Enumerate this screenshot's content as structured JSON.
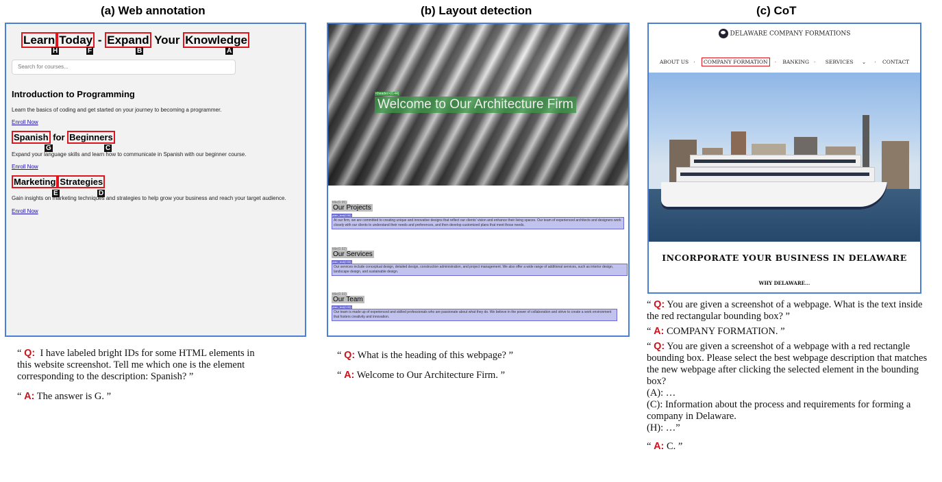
{
  "titles": {
    "a": "(a) Web annotation",
    "b": "(b) Layout detection",
    "c": "(c) CoT"
  },
  "panel_a": {
    "heading_words": [
      "Learn",
      "Today",
      "-",
      "Expand",
      "Your",
      "Knowledge"
    ],
    "heading_marks": [
      "H",
      "F",
      "B",
      "A"
    ],
    "search_placeholder": "Search for courses...",
    "courses": [
      {
        "title": "Introduction to Programming",
        "desc": "Learn the basics of coding and get started on your journey to becoming a programmer.",
        "link": "Enroll Now"
      },
      {
        "title_words": [
          "Spanish",
          "for",
          "Beginners"
        ],
        "marks": [
          "G",
          "C"
        ],
        "desc": "Expand your language skills and learn how to communicate in Spanish with our beginner course.",
        "link": "Enroll Now"
      },
      {
        "title_words": [
          "Marketing",
          "Strategies"
        ],
        "marks": [
          "E",
          "D"
        ],
        "desc": "Gain insights on marketing techniques and strategies to help grow your business and reach your target audience.",
        "link": "Enroll Now"
      }
    ]
  },
  "panel_b": {
    "hero_tag": "<header>(0.44)",
    "hero_heading": "Welcome to Our Architecture Firm",
    "sections": [
      {
        "tag": "title(0.95)",
        "title": "Our Projects",
        "ptag": "plain_text(0.95)",
        "text": "At our firm, we are committed to creating unique and innovative designs that reflect our clients' vision and enhance their living spaces. Our team of experienced architects and designers work closely with our clients to understand their needs and preferences, and then develop customized plans that meet those needs."
      },
      {
        "tag": "title(0.92)",
        "title": "Our Services",
        "ptag": "plain_text(0.93)",
        "text": "Our services include conceptual design, detailed design, construction administration, and project management. We also offer a wide range of additional services, such as interior design, landscape design, and sustainable design."
      },
      {
        "tag": "title(0.93)",
        "title": "Our Team",
        "ptag": "plain_text(0.93)",
        "text": "Our team is made up of experienced and skilled professionals who are passionate about what they do. We believe in the power of collaboration and strive to create a work environment that fosters creativity and innovation."
      }
    ]
  },
  "panel_c": {
    "logo_text": "DELAWARE COMPANY FORMATIONS",
    "nav": [
      "ABOUT US",
      "COMPANY FORMATION",
      "BANKING",
      "SERVICES",
      "CONTACT"
    ],
    "nav_selected": "COMPANY FORMATION",
    "services_caret": "⌄",
    "headline": "INCORPORATE YOUR BUSINESS IN DELAWARE",
    "sub": "WHY DELAWARE..."
  },
  "qa": {
    "a": {
      "q_label": "Q",
      "q_text": "I have labeled bright IDs for some HTML elements in this website screenshot. Tell me which one is the element corresponding to the description: Spanish? ”",
      "a_label": "A",
      "a_text": "The answer is G. ”"
    },
    "b": {
      "q_label": "Q",
      "q_text": "What is the heading of this webpage? ”",
      "a_label": "A",
      "a_text": "Welcome to Our Architecture Firm. ”"
    },
    "c": {
      "q1_label": "Q",
      "q1_text": "You are given a screenshot of a webpage. What is the text inside the red rectangular bounding box? ”",
      "a1_label": "A",
      "a1_text": "COMPANY FORMATION. ”",
      "q2_label": "Q",
      "q2_text": "You are given a screenshot of a webpage with a red rectangle bounding box. Please select the best webpage description that matches the new webpage after clicking the selected element in the bounding box?",
      "opt_a": "(A): …",
      "opt_c": "(C): Information about the process and requirements for forming a company in Delaware.",
      "opt_h": "(H): …”",
      "a2_label": "A",
      "a2_text": "C. ”"
    }
  }
}
